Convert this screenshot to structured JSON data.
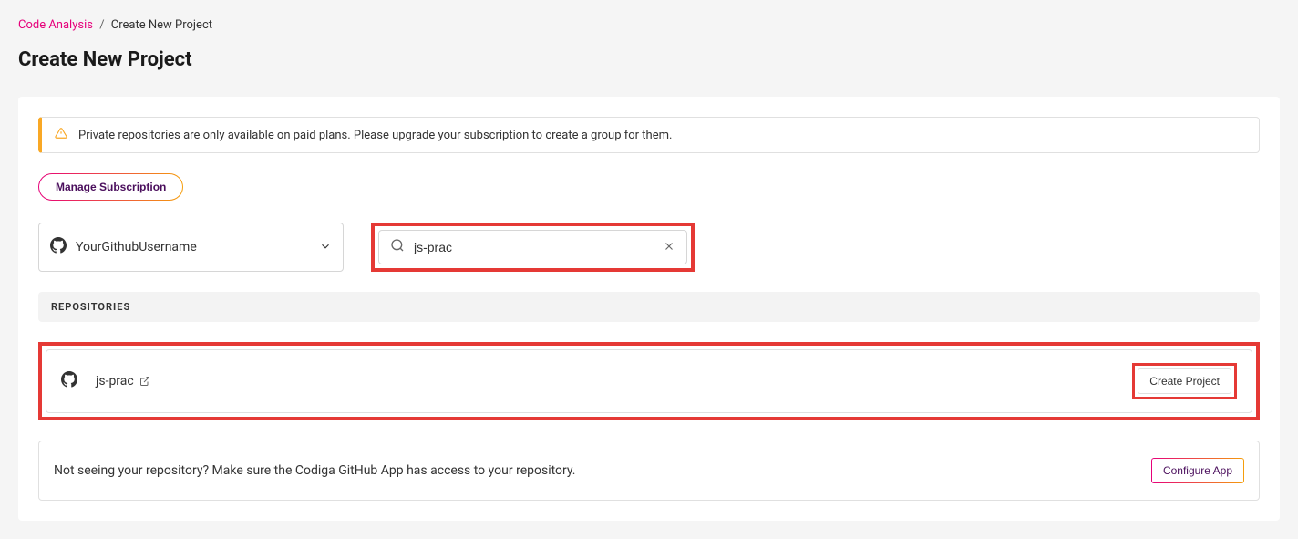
{
  "breadcrumb": {
    "parent": "Code Analysis",
    "current": "Create New Project"
  },
  "page": {
    "title": "Create New Project"
  },
  "alert": {
    "text": "Private repositories are only available on paid plans. Please upgrade your subscription to create a group for them."
  },
  "buttons": {
    "manage_subscription": "Manage Subscription",
    "create_project": "Create Project",
    "configure_app": "Configure App"
  },
  "account_select": {
    "value": "YourGithubUsername"
  },
  "search": {
    "value": "js-prac"
  },
  "sections": {
    "repositories_header": "REPOSITORIES"
  },
  "repos": [
    {
      "name": "js-prac"
    }
  ],
  "footer": {
    "text": "Not seeing your repository? Make sure the Codiga GitHub App has access to your repository."
  }
}
